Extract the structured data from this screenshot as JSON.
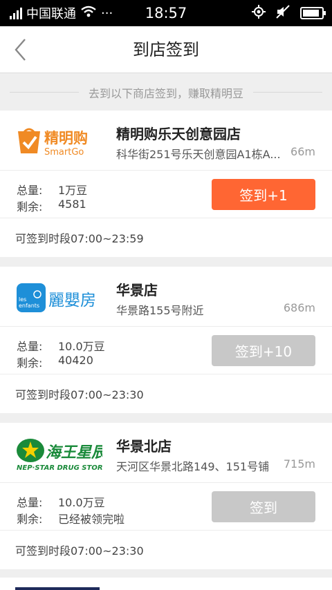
{
  "status_bar": {
    "carrier": "中国联通",
    "dots": "···",
    "time": "18:57",
    "battery_level": 0.9
  },
  "nav": {
    "title": "到店签到"
  },
  "hint": "去到以下商店签到，赚取精明豆",
  "labels": {
    "total": "总量:",
    "remain": "剩余:"
  },
  "stores": [
    {
      "name": "精明购乐天创意园店",
      "address": "科华街251号乐天创意园A1栋A...",
      "distance": "66m",
      "total": "1万豆",
      "remain": "4581",
      "button": "签到+1",
      "button_state": "active",
      "time": "可签到时段07:00~23:59",
      "logo": {
        "main": "精明购",
        "sub": "SmartGo",
        "color": "#f08a24"
      }
    },
    {
      "name": "华景店",
      "address": "华景路155号附近",
      "distance": "686m",
      "total": "10.0万豆",
      "remain": "40420",
      "button": "签到+10",
      "button_state": "disabled",
      "time": "可签到时段07:00~23:30",
      "logo": {
        "main": "麗嬰房",
        "small_top": "les",
        "small_bottom": "enfants",
        "color": "#1e8fd8"
      }
    },
    {
      "name": "华景北店",
      "address": "天河区华景北路149、151号铺",
      "distance": "715m",
      "total": "10.0万豆",
      "remain": "已经被领完啦",
      "button": "签到",
      "button_state": "disabled",
      "time": "可签到时段07:00~23:30",
      "logo": {
        "main": "海王星辰",
        "sub": "NEP·STAR DRUG STORE",
        "color": "#1a8a3a"
      }
    }
  ]
}
